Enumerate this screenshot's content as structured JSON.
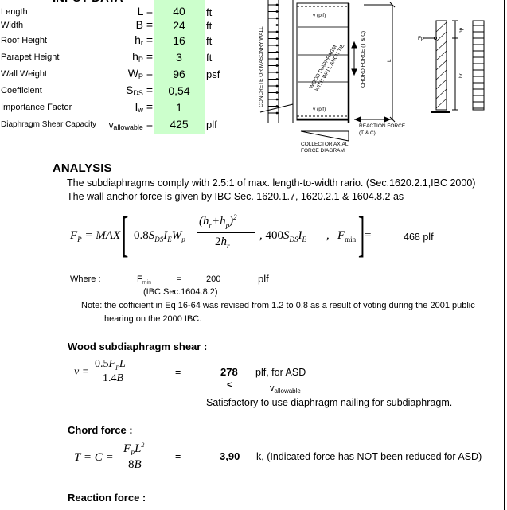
{
  "input_data": {
    "header": "INPUT DATA",
    "rows": [
      {
        "label": "Length",
        "symbol": "L",
        "sub": "",
        "value": "40",
        "unit": "ft"
      },
      {
        "label": "Width",
        "symbol": "B",
        "sub": "",
        "value": "24",
        "unit": "ft"
      },
      {
        "label": "Roof Height",
        "symbol": "h",
        "sub": "r",
        "value": "16",
        "unit": "ft"
      },
      {
        "label": "Parapet Height",
        "symbol": "h",
        "sub": "P",
        "value": "3",
        "unit": "ft"
      },
      {
        "label": "Wall Weight",
        "symbol": "W",
        "sub": "P",
        "value": "96",
        "unit": "psf"
      },
      {
        "label": "Coefficient",
        "symbol": "S",
        "sub": "DS",
        "value": "0,54",
        "unit": ""
      },
      {
        "label": "Importance Factor",
        "symbol": "I",
        "sub": "w",
        "value": "1",
        "unit": ""
      },
      {
        "label": "Diaphragm Shear Capacity",
        "symbol": "v",
        "sub": "allowable",
        "value": "425",
        "unit": "plf"
      }
    ],
    "equals": "="
  },
  "diagram": {
    "wall_label": "CONCRETE OR MASONRY WALL",
    "v_top": "v (plf)",
    "v_bottom": "v (plf)",
    "diaphragm_label_1": "WOOD DIAPHRAGM",
    "diaphragm_label_2": "WITH WALL ANCH TIE",
    "chord_label": "CHORD FORCE (T & C)",
    "length_label": "L",
    "reaction_label_1": "REACTION FORCE",
    "reaction_label_2": "(T & C)",
    "collector_label_1": "COLLECTOR AXIAL",
    "collector_label_2": "FORCE DIAGRAM",
    "fp_label": "Fp",
    "hp_label": "hp",
    "hr_label": "hr"
  },
  "analysis": {
    "title": "ANALYSIS",
    "line1": "The subdiaphragms comply with 2.5:1 of max. length-to-width rario. (Sec.1620.2.1,IBC 2000)",
    "line2": "The wall anchor force is given by IBC Sec. 1620.1.7, 1620.2.1 & 1604.8.2 as",
    "fp_result": "468",
    "fp_unit": "plf",
    "where_label": "Where :",
    "fmin_symbol": "F",
    "fmin_sub": "min",
    "fmin_eq": "=",
    "fmin_value": "200",
    "fmin_unit": "plf",
    "fmin_ref": "(IBC Sec.1604.8.2)",
    "note_label": "Note:",
    "note_line1": "the cofficient in Eq 16-64 was revised from 1.2 to 0.8 as a result of voting during the 2001 public",
    "note_line2": "hearing on the 2000 IBC."
  },
  "shear": {
    "title": "Wood subdiaphragm shear :",
    "eq": "=",
    "value": "278",
    "unit": "plf, for ASD",
    "compare": "<",
    "compare_sym": "v",
    "compare_sub": "allowable",
    "conclusion": "Satisfactory to use diaphragm nailing for subdiaphragm."
  },
  "chord": {
    "title": "Chord force :",
    "eq": "=",
    "value": "3,90",
    "unit": "k, (Indicated force has NOT been reduced for ASD)"
  },
  "reaction": {
    "title": "Reaction force :"
  }
}
